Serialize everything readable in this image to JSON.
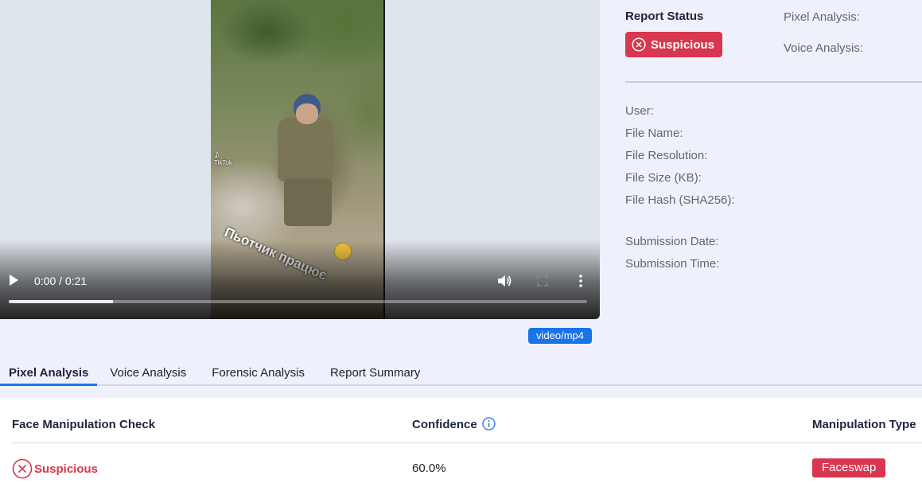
{
  "player": {
    "time": "0:00 / 0:21",
    "progress_fraction": 0.18,
    "watermark": "TikTok",
    "overlay_caption": "Пьотчик працює",
    "mime_type": "video/mp4"
  },
  "report": {
    "status_title": "Report Status",
    "status_value": "Suspicious",
    "pixel_analysis_label": "Pixel Analysis:",
    "voice_analysis_label": "Voice Analysis:"
  },
  "file_meta": {
    "user_label": "User:",
    "file_name_label": "File Name:",
    "file_resolution_label": "File Resolution:",
    "file_size_label": "File Size (KB):",
    "file_hash_label": "File Hash (SHA256):",
    "submission_date_label": "Submission Date:",
    "submission_time_label": "Submission Time:"
  },
  "tabs": [
    {
      "label": "Pixel Analysis",
      "active": true
    },
    {
      "label": "Voice Analysis",
      "active": false
    },
    {
      "label": "Forensic Analysis",
      "active": false
    },
    {
      "label": "Report Summary",
      "active": false
    }
  ],
  "results": {
    "headers": {
      "check": "Face Manipulation Check",
      "confidence": "Confidence",
      "type": "Manipulation Type"
    },
    "row": {
      "check_result": "Suspicious",
      "confidence": "60.0%",
      "manipulation_type": "Faceswap"
    }
  },
  "colors": {
    "accent": "#1a73e8",
    "danger": "#d9364f",
    "background": "#eef0fb"
  }
}
